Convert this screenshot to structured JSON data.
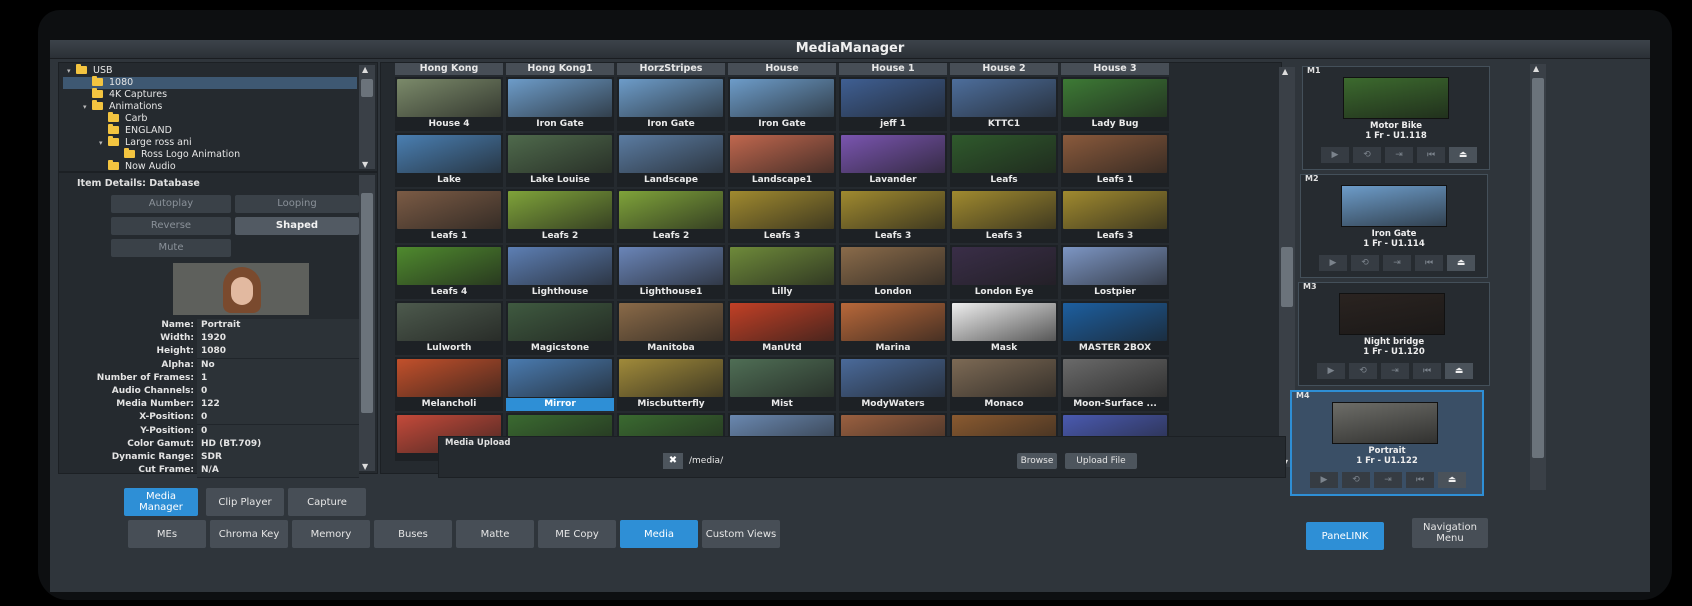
{
  "app": {
    "title": "MediaManager"
  },
  "tree": {
    "items": [
      {
        "label": "USB",
        "depth": 0,
        "selected": false
      },
      {
        "label": "1080",
        "depth": 1,
        "selected": true
      },
      {
        "label": "4K Captures",
        "depth": 1,
        "selected": false
      },
      {
        "label": "Animations",
        "depth": 1,
        "selected": false
      },
      {
        "label": "Carb",
        "depth": 2,
        "selected": false
      },
      {
        "label": "ENGLAND",
        "depth": 2,
        "selected": false
      },
      {
        "label": "Large ross ani",
        "depth": 2,
        "selected": false
      },
      {
        "label": "Ross Logo Animation",
        "depth": 3,
        "selected": false
      },
      {
        "label": "Now Audio",
        "depth": 2,
        "selected": false
      }
    ]
  },
  "details": {
    "header": "Item Details: Database",
    "options": {
      "autoplay": "Autoplay",
      "looping": "Looping",
      "reverse": "Reverse",
      "shaped": "Shaped",
      "mute": "Mute"
    },
    "props": [
      {
        "key": "Name:",
        "value": "Portrait"
      },
      {
        "key": "Width:",
        "value": "1920"
      },
      {
        "key": "Height:",
        "value": "1080"
      },
      {
        "key": "Alpha:",
        "value": "No"
      },
      {
        "key": "Number of Frames:",
        "value": "1"
      },
      {
        "key": "Audio Channels:",
        "value": "0"
      },
      {
        "key": "Media Number:",
        "value": "122"
      },
      {
        "key": "X-Position:",
        "value": "0"
      },
      {
        "key": "Y-Position:",
        "value": "0"
      },
      {
        "key": "Color Gamut:",
        "value": "HD (BT.709)"
      },
      {
        "key": "Dynamic Range:",
        "value": "SDR"
      },
      {
        "key": "Cut Frame:",
        "value": "N/A"
      }
    ]
  },
  "grid": {
    "headers": [
      "Hong Kong",
      "Hong Kong1",
      "HorzStripes",
      "House",
      "House 1",
      "House 2",
      "House 3"
    ],
    "rows": [
      [
        {
          "label": "House 4",
          "bg": "#7b8a6a"
        },
        {
          "label": "Iron Gate",
          "bg": "#6d9cc9"
        },
        {
          "label": "Iron Gate",
          "bg": "#6d9cc9"
        },
        {
          "label": "Iron Gate",
          "bg": "#6d9cc9"
        },
        {
          "label": "jeff 1",
          "bg": "#3f5f93"
        },
        {
          "label": "KTTC1",
          "bg": "#4d6e9c"
        },
        {
          "label": "Lady Bug",
          "bg": "#3d7a35"
        }
      ],
      [
        {
          "label": "Lake",
          "bg": "#4a7fb2"
        },
        {
          "label": "Lake Louise",
          "bg": "#4f6a4c"
        },
        {
          "label": "Landscape",
          "bg": "#5b7ca2"
        },
        {
          "label": "Landscape1",
          "bg": "#c0674e"
        },
        {
          "label": "Lavander",
          "bg": "#7a55b0"
        },
        {
          "label": "Leafs",
          "bg": "#2f5a2c"
        },
        {
          "label": "Leafs 1",
          "bg": "#8a5a3c"
        }
      ],
      [
        {
          "label": "Leafs 1",
          "bg": "#7b5b45"
        },
        {
          "label": "Leafs 2",
          "bg": "#7fa33a"
        },
        {
          "label": "Leafs 2",
          "bg": "#7fa33a"
        },
        {
          "label": "Leafs 3",
          "bg": "#a08a2f"
        },
        {
          "label": "Leafs 3",
          "bg": "#a08a2f"
        },
        {
          "label": "Leafs 3",
          "bg": "#a08a2f"
        },
        {
          "label": "Leafs 3",
          "bg": "#a08a2f"
        }
      ],
      [
        {
          "label": "Leafs 4",
          "bg": "#4f8a2e"
        },
        {
          "label": "Lighthouse",
          "bg": "#5d7fb4"
        },
        {
          "label": "Lighthouse1",
          "bg": "#6a85b8"
        },
        {
          "label": "Lilly",
          "bg": "#6e8a3a"
        },
        {
          "label": "London",
          "bg": "#8a6b4a"
        },
        {
          "label": "London Eye",
          "bg": "#3a2e48"
        },
        {
          "label": "Lostpier",
          "bg": "#7d96c4"
        }
      ],
      [
        {
          "label": "Lulworth",
          "bg": "#4d5a4d"
        },
        {
          "label": "Magicstone",
          "bg": "#3f5a40"
        },
        {
          "label": "Manitoba",
          "bg": "#8a6a48"
        },
        {
          "label": "ManUtd",
          "bg": "#c24026"
        },
        {
          "label": "Marina",
          "bg": "#b8683a"
        },
        {
          "label": "Mask",
          "bg": "#eeeeee"
        },
        {
          "label": "MASTER 2BOX",
          "bg": "#1d5fa0"
        }
      ],
      [
        {
          "label": "Melancholi",
          "bg": "#c2502b"
        },
        {
          "label": "Mirror",
          "bg": "#4a7bb0",
          "highlight": true
        },
        {
          "label": "Miscbutterfly",
          "bg": "#a08a3a"
        },
        {
          "label": "Mist",
          "bg": "#4f6e55"
        },
        {
          "label": "ModyWaters",
          "bg": "#4a6a9a"
        },
        {
          "label": "Monaco",
          "bg": "#7d6a55"
        },
        {
          "label": "Moon-Surface ...",
          "bg": "#6a6a6a"
        }
      ],
      [
        {
          "label": "",
          "bg": "#c44a3a"
        },
        {
          "label": "",
          "bg": "#3a6a30"
        },
        {
          "label": "",
          "bg": "#3a6a30"
        },
        {
          "label": "",
          "bg": "#6a88b0"
        },
        {
          "label": "",
          "bg": "#9a6040"
        },
        {
          "label": "",
          "bg": "#8a5a30"
        },
        {
          "label": "",
          "bg": "#4a5ab0"
        }
      ]
    ]
  },
  "upload": {
    "title": "Media Upload",
    "path": "/media/",
    "browse": "Browse",
    "upload": "Upload File"
  },
  "channels": [
    {
      "id": "M1",
      "name": "Motor Bike",
      "info": "1 Fr - U1.118",
      "bg": "#3c6a2e",
      "active": false
    },
    {
      "id": "M2",
      "name": "Iron Gate",
      "info": "1 Fr - U1.114",
      "bg": "#6d9cc9",
      "active": false
    },
    {
      "id": "M3",
      "name": "Night bridge",
      "info": "1 Fr - U1.120",
      "bg": "#2a2320",
      "active": false
    },
    {
      "id": "M4",
      "name": "Portrait",
      "info": "1 Fr - U1.122",
      "bg": "#6d6d68",
      "active": true
    }
  ],
  "tabs_top": [
    {
      "label": "Media Manager",
      "active": true
    },
    {
      "label": "Clip Player",
      "active": false
    },
    {
      "label": "Capture",
      "active": false
    }
  ],
  "tabs_bottom": [
    {
      "label": "MEs",
      "active": false
    },
    {
      "label": "Chroma Key",
      "active": false
    },
    {
      "label": "Memory",
      "active": false
    },
    {
      "label": "Buses",
      "active": false
    },
    {
      "label": "Matte",
      "active": false
    },
    {
      "label": "ME Copy",
      "active": false
    },
    {
      "label": "Media",
      "active": true
    },
    {
      "label": "Custom Views",
      "active": false
    }
  ],
  "panelink": "PaneLINK",
  "navmenu": "Navigation Menu"
}
